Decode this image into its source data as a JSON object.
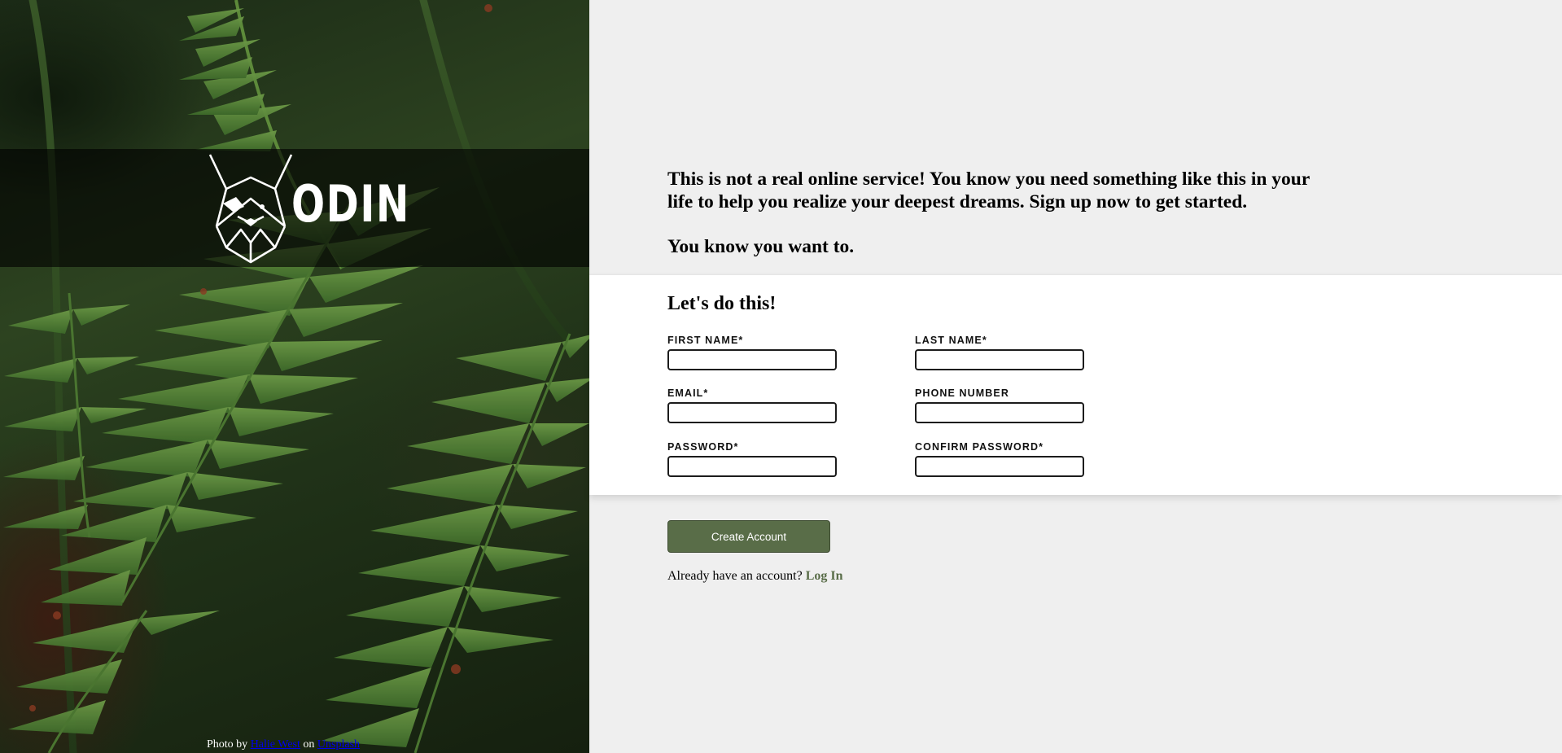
{
  "brand": {
    "name": "ODIN",
    "logo_icon": "viking-helmet-dog-icon"
  },
  "credit": {
    "prefix": "Photo by",
    "author": "Halie West",
    "middle": "on",
    "source": "Unsplash"
  },
  "intro": {
    "paragraph1": "This is not a real online service! You know you need something like this in your life to help you realize your deepest dreams. Sign up now to get started.",
    "paragraph2": "You know you want to."
  },
  "form": {
    "title": "Let's do this!",
    "fields": [
      {
        "label": "FIRST NAME*",
        "value": ""
      },
      {
        "label": "LAST NAME*",
        "value": ""
      },
      {
        "label": "EMAIL*",
        "value": ""
      },
      {
        "label": "PHONE NUMBER",
        "value": ""
      },
      {
        "label": "PASSWORD*",
        "value": ""
      },
      {
        "label": "CONFIRM PASSWORD*",
        "value": ""
      }
    ],
    "submit_label": "Create Account"
  },
  "login": {
    "prompt": "Already have an account?",
    "link_label": "Log In"
  },
  "colors": {
    "accent": "#596d48",
    "panel": "#ffffff",
    "page_bg": "#efefef"
  }
}
